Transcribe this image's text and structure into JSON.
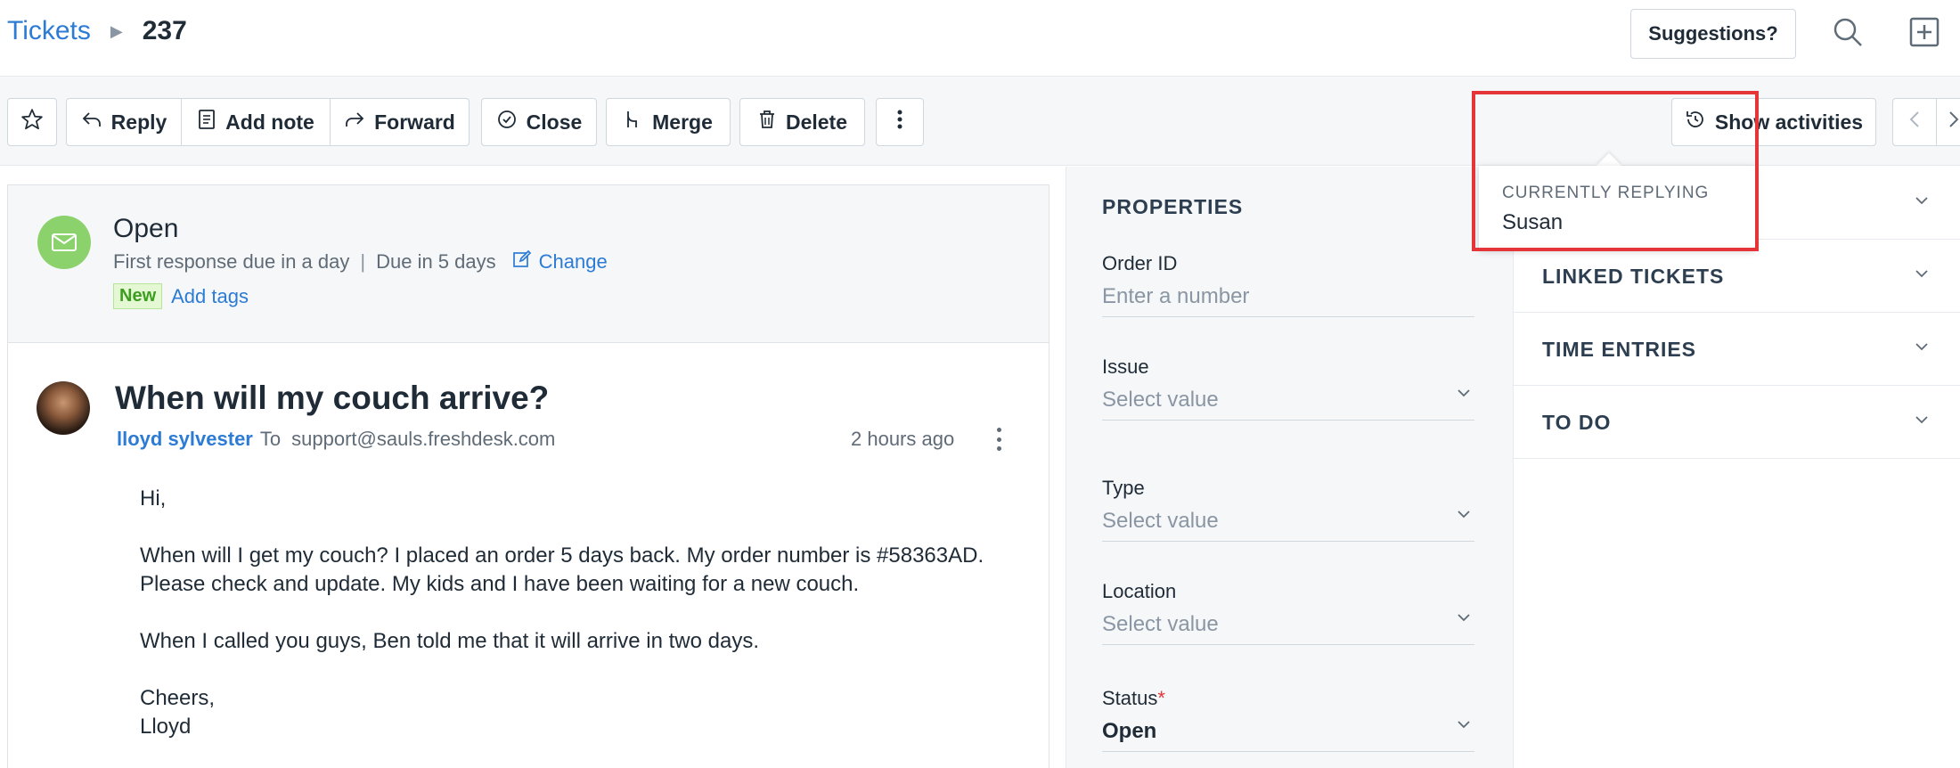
{
  "breadcrumb": {
    "root": "Tickets",
    "ticket_id": "237"
  },
  "header": {
    "suggestions_label": "Suggestions?"
  },
  "toolbar": {
    "reply": "Reply",
    "add_note": "Add note",
    "forward": "Forward",
    "close": "Close",
    "merge": "Merge",
    "delete": "Delete",
    "show_activities": "Show activities"
  },
  "status": {
    "title": "Open",
    "first_response": "First response due in a day",
    "due": "Due in 5 days",
    "change": "Change",
    "badge": "New",
    "add_tags": "Add tags"
  },
  "message": {
    "subject": "When will my couch arrive?",
    "sender": "lloyd sylvester",
    "to_label": "To",
    "recipient": "support@sauls.freshdesk.com",
    "time": "2 hours ago",
    "greeting": "Hi,",
    "para1": "When will I get my couch? I placed an order 5 days back. My order number is #58363AD. Please check and update. My kids and I have been waiting for a new couch.",
    "para2": "When I called you guys,  Ben told me that it will arrive in two days.",
    "closing": "Cheers,",
    "signature": "Lloyd"
  },
  "properties": {
    "title": "PROPERTIES",
    "order_id": {
      "label": "Order ID",
      "placeholder": "Enter a number"
    },
    "issue": {
      "label": "Issue",
      "value": "Select value"
    },
    "type": {
      "label": "Type",
      "value": "Select value"
    },
    "location": {
      "label": "Location",
      "value": "Select value"
    },
    "status": {
      "label": "Status",
      "required_mark": "*",
      "value": "Open"
    }
  },
  "side_sections": [
    "LINKED TICKETS",
    "TIME ENTRIES",
    "TO DO"
  ],
  "popover": {
    "heading": "CURRENTLY REPLYING",
    "name": "Susan"
  },
  "colors": {
    "link": "#2c7bd4",
    "accent_green": "#2aa77a",
    "highlight": "#e43538"
  }
}
